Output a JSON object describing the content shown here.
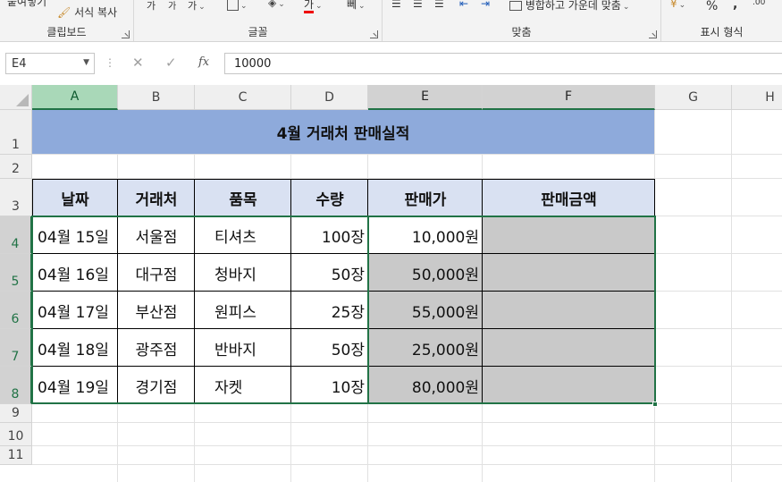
{
  "ribbon": {
    "clipboard": {
      "label": "클립보드",
      "paste_label": "붙여넣기",
      "format_painter_label": "서식 복사"
    },
    "font": {
      "label": "글꼴",
      "grow_font": "가",
      "shrink_font": "가",
      "phonetic": "가"
    },
    "alignment": {
      "label": "맞춤",
      "merge_center_label": "병합하고 가운데 맞춤"
    },
    "number": {
      "label": "표시 형식",
      "percent": "%",
      "comma": ","
    }
  },
  "formula_bar": {
    "name_box": "E4",
    "fx": "fx",
    "cancel": "✕",
    "enter": "✓",
    "value": "10000"
  },
  "columns": [
    "A",
    "B",
    "C",
    "D",
    "E",
    "F",
    "G",
    "H"
  ],
  "rows": [
    "1",
    "2",
    "3",
    "4",
    "5",
    "6",
    "7",
    "8",
    "9",
    "10",
    "11"
  ],
  "sheet": {
    "title": "4월 거래처 판매실적",
    "headers": [
      "날짜",
      "거래처",
      "품목",
      "수량",
      "판매가",
      "판매금액"
    ],
    "records": [
      {
        "date": "04월 15일",
        "client": "서울점",
        "item": "티셔츠",
        "qty": "100장",
        "price": "10,000원",
        "amount": ""
      },
      {
        "date": "04월 16일",
        "client": "대구점",
        "item": "청바지",
        "qty": "50장",
        "price": "50,000원",
        "amount": ""
      },
      {
        "date": "04월 17일",
        "client": "부산점",
        "item": "원피스",
        "qty": "25장",
        "price": "55,000원",
        "amount": ""
      },
      {
        "date": "04월 18일",
        "client": "광주점",
        "item": "반바지",
        "qty": "50장",
        "price": "25,000원",
        "amount": ""
      },
      {
        "date": "04월 19일",
        "client": "경기점",
        "item": "자켓",
        "qty": "10장",
        "price": "80,000원",
        "amount": ""
      }
    ]
  },
  "colors": {
    "title_fill": "#8eaadb",
    "header_fill": "#d9e1f2",
    "selection_fill": "#c9c9c9",
    "excel_green": "#217346"
  }
}
